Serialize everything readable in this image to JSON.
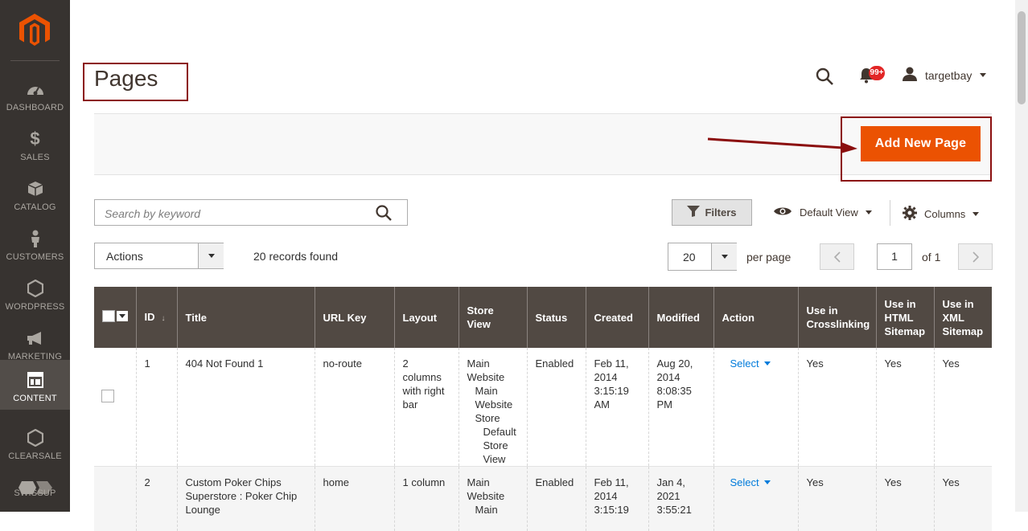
{
  "sidebar": {
    "logo": "magento-logo",
    "items": [
      {
        "label": "DASHBOARD",
        "icon": "dashboard-icon"
      },
      {
        "label": "SALES",
        "icon": "dollar-icon"
      },
      {
        "label": "CATALOG",
        "icon": "box-icon"
      },
      {
        "label": "CUSTOMERS",
        "icon": "person-icon"
      },
      {
        "label": "WORDPRESS",
        "icon": "hexagon-icon"
      },
      {
        "label": "MARKETING",
        "icon": "megaphone-icon"
      },
      {
        "label": "CONTENT",
        "icon": "layout-icon",
        "active": true
      },
      {
        "label": "CLEARSALE",
        "icon": "hexagon-icon"
      },
      {
        "label": "SWISSUP",
        "icon": "swissup-icon"
      }
    ]
  },
  "header": {
    "title": "Pages",
    "notifications_badge": "99+",
    "user_name": "targetbay"
  },
  "action_bar": {
    "add_button_label": "Add New Page"
  },
  "toolbar": {
    "search_placeholder": "Search by keyword",
    "filters_label": "Filters",
    "view_label": "Default View",
    "columns_label": "Columns",
    "actions_label": "Actions",
    "records_found": "20 records found",
    "per_page_value": "20",
    "per_page_label": "per page",
    "page_current": "1",
    "page_of": "of 1"
  },
  "grid": {
    "columns": {
      "id": "ID",
      "title": "Title",
      "url_key": "URL Key",
      "layout": "Layout",
      "store_view": "Store View",
      "status": "Status",
      "created": "Created",
      "modified": "Modified",
      "action": "Action",
      "crosslinking": "Use in Crosslinking",
      "html_sitemap": "Use in HTML Sitemap",
      "xml_sitemap": "Use in XML Sitemap"
    },
    "rows": [
      {
        "id": "1",
        "title": "404 Not Found 1",
        "url_key": "no-route",
        "layout": "2 columns with right bar",
        "store_view": [
          "Main Website",
          "Main Website Store",
          "Default Store View"
        ],
        "status": "Enabled",
        "created": "Feb 11, 2014 3:15:19 AM",
        "modified": "Aug 20, 2014 8:08:35 PM",
        "action": "Select",
        "crosslinking": "Yes",
        "html_sitemap": "Yes",
        "xml_sitemap": "Yes"
      },
      {
        "id": "2",
        "title": "Custom Poker Chips Superstore : Poker Chip Lounge",
        "url_key": "home",
        "layout": "1 column",
        "store_view": [
          "Main Website",
          "Main"
        ],
        "status": "Enabled",
        "created": "Feb 11, 2014 3:15:19",
        "modified": "Jan 4, 2021 3:55:21",
        "action": "Select",
        "crosslinking": "Yes",
        "html_sitemap": "Yes",
        "xml_sitemap": "Yes"
      }
    ]
  },
  "colors": {
    "sidebar_bg": "#373330",
    "accent_orange": "#eb5202",
    "grid_header_bg": "#514943",
    "link_blue": "#007bdb",
    "annotation_red": "#8b0e0e"
  }
}
